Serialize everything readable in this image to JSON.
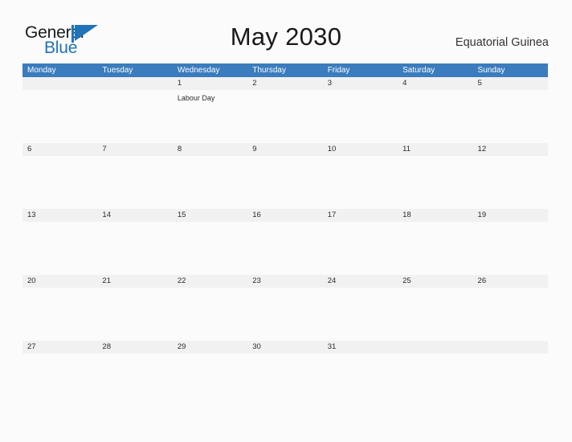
{
  "brand": {
    "name_part1": "General",
    "name_part2": "Blue",
    "flag_icon": "flag-triangle-icon"
  },
  "header": {
    "title": "May 2030",
    "locale": "Equatorial Guinea"
  },
  "colors": {
    "header_blue": "#3a7cbd",
    "rule_blue": "#2a6ca8",
    "day_strip_gray": "#f1f1f1",
    "page_background": "#fbfbfb",
    "brand_blue": "#2173b8",
    "text_dark": "#1a1a1a"
  },
  "calendar": {
    "month": "May",
    "year": "2030",
    "weekday_headers": [
      "Monday",
      "Tuesday",
      "Wednesday",
      "Thursday",
      "Friday",
      "Saturday",
      "Sunday"
    ],
    "weeks": [
      {
        "days": [
          {
            "num": "",
            "events": []
          },
          {
            "num": "",
            "events": []
          },
          {
            "num": "1",
            "events": [
              "Labour Day"
            ]
          },
          {
            "num": "2",
            "events": []
          },
          {
            "num": "3",
            "events": []
          },
          {
            "num": "4",
            "events": []
          },
          {
            "num": "5",
            "events": []
          }
        ]
      },
      {
        "days": [
          {
            "num": "6",
            "events": []
          },
          {
            "num": "7",
            "events": []
          },
          {
            "num": "8",
            "events": []
          },
          {
            "num": "9",
            "events": []
          },
          {
            "num": "10",
            "events": []
          },
          {
            "num": "11",
            "events": []
          },
          {
            "num": "12",
            "events": []
          }
        ]
      },
      {
        "days": [
          {
            "num": "13",
            "events": []
          },
          {
            "num": "14",
            "events": []
          },
          {
            "num": "15",
            "events": []
          },
          {
            "num": "16",
            "events": []
          },
          {
            "num": "17",
            "events": []
          },
          {
            "num": "18",
            "events": []
          },
          {
            "num": "19",
            "events": []
          }
        ]
      },
      {
        "days": [
          {
            "num": "20",
            "events": []
          },
          {
            "num": "21",
            "events": []
          },
          {
            "num": "22",
            "events": []
          },
          {
            "num": "23",
            "events": []
          },
          {
            "num": "24",
            "events": []
          },
          {
            "num": "25",
            "events": []
          },
          {
            "num": "26",
            "events": []
          }
        ]
      },
      {
        "days": [
          {
            "num": "27",
            "events": []
          },
          {
            "num": "28",
            "events": []
          },
          {
            "num": "29",
            "events": []
          },
          {
            "num": "30",
            "events": []
          },
          {
            "num": "31",
            "events": []
          },
          {
            "num": "",
            "events": []
          },
          {
            "num": "",
            "events": []
          }
        ]
      }
    ]
  }
}
